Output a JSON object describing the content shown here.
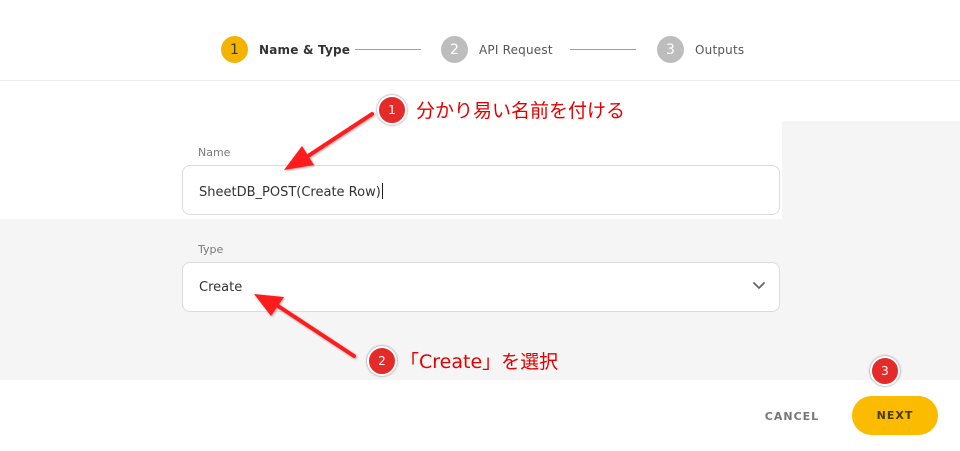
{
  "stepper": {
    "steps": [
      {
        "num": "1",
        "label": "Name & Type"
      },
      {
        "num": "2",
        "label": "API Request"
      },
      {
        "num": "3",
        "label": "Outputs"
      }
    ]
  },
  "form": {
    "name_label": "Name",
    "name_value": "SheetDB_POST(Create Row)",
    "type_label": "Type",
    "type_value": "Create"
  },
  "footer": {
    "cancel_label": "CANCEL",
    "next_label": "NEXT"
  },
  "annotations": [
    {
      "num": "1",
      "text": "分かり易い名前を付ける"
    },
    {
      "num": "2",
      "text": "「Create」を選択"
    },
    {
      "num": "3",
      "text": ""
    }
  ],
  "colors": {
    "accent": "#fbbb00",
    "annotation_red": "#e52a2a",
    "inactive_step": "#bdbdbd"
  }
}
